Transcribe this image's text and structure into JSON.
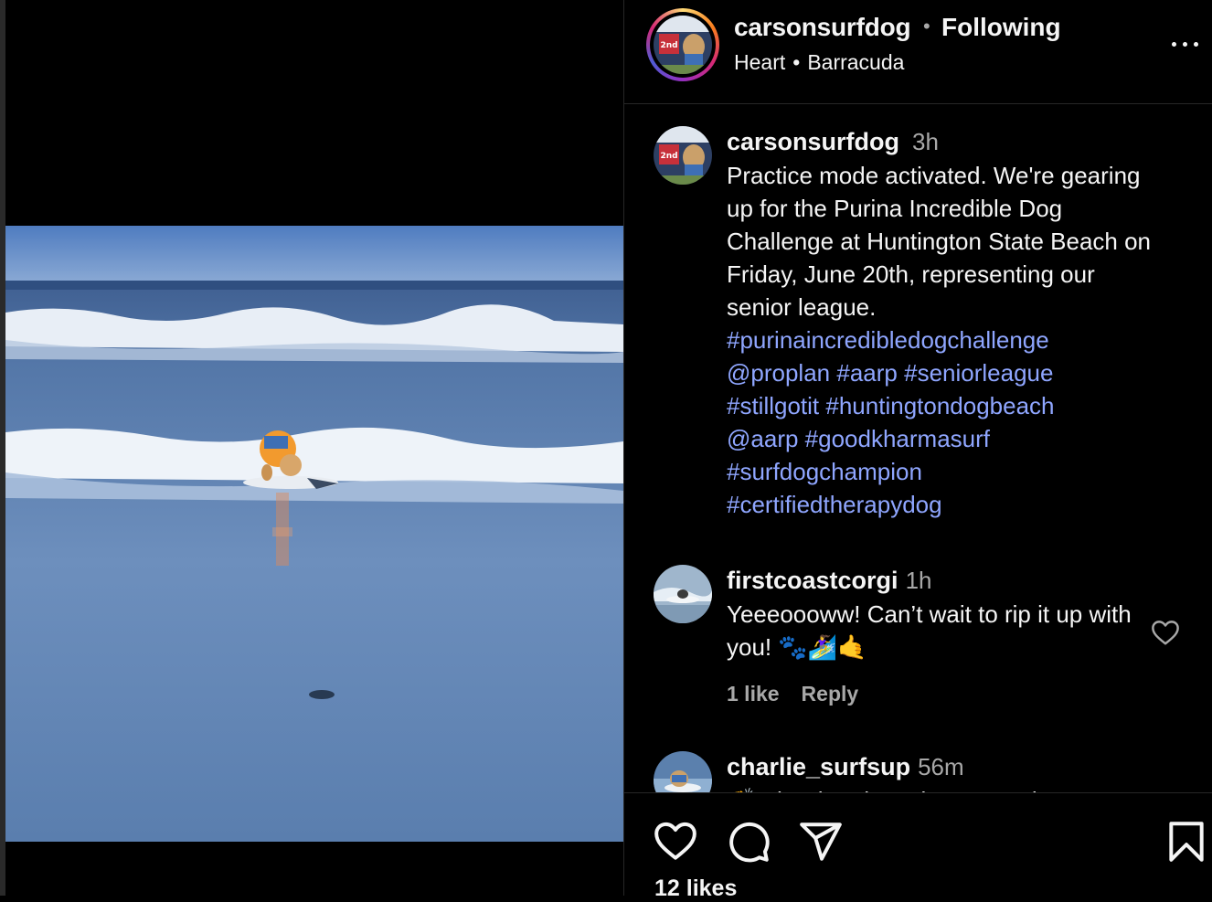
{
  "post": {
    "username": "carsonsurfdog",
    "follow_state": "Following",
    "audio_song": "Heart",
    "audio_artist": "Barracuda",
    "caption_time": "3h",
    "caption_plain": "Practice mode activated. We're gearing up for the Purina Incredible Dog Challenge at Huntington State Beach on Friday, June 20th, representing our senior league.",
    "caption_tags": [
      "#purinaincredibledogchallenge",
      "@proplan",
      "#aarp",
      "#seniorleague",
      "#stillgotit",
      "#huntingtondogbeach",
      "@aarp",
      "#goodkharmasurf",
      "#surfdogchampion",
      "#certifiedtherapydog"
    ],
    "avatar_badge": "2nd"
  },
  "comments": [
    {
      "username": "firstcoastcorgi",
      "time": "1h",
      "text": "Yeeeoooww! Can’t wait to rip it up with you! 🐾🏄‍♀️🤙",
      "likes_label": "1 like",
      "reply_label": "Reply"
    },
    {
      "username": "charlie_surfsup",
      "time": "56m",
      "text": "👏 The deer is !!!! let you and"
    }
  ],
  "footer": {
    "likes_label": "12 likes"
  },
  "icons": {
    "more": "more-horizontal-icon",
    "like": "heart-icon",
    "comment": "comment-bubble-icon",
    "share": "send-paper-plane-icon",
    "save": "bookmark-icon"
  },
  "colors": {
    "background": "#000000",
    "text": "#f5f5f5",
    "muted": "#a8a8a8",
    "link": "#8fa6ff"
  }
}
